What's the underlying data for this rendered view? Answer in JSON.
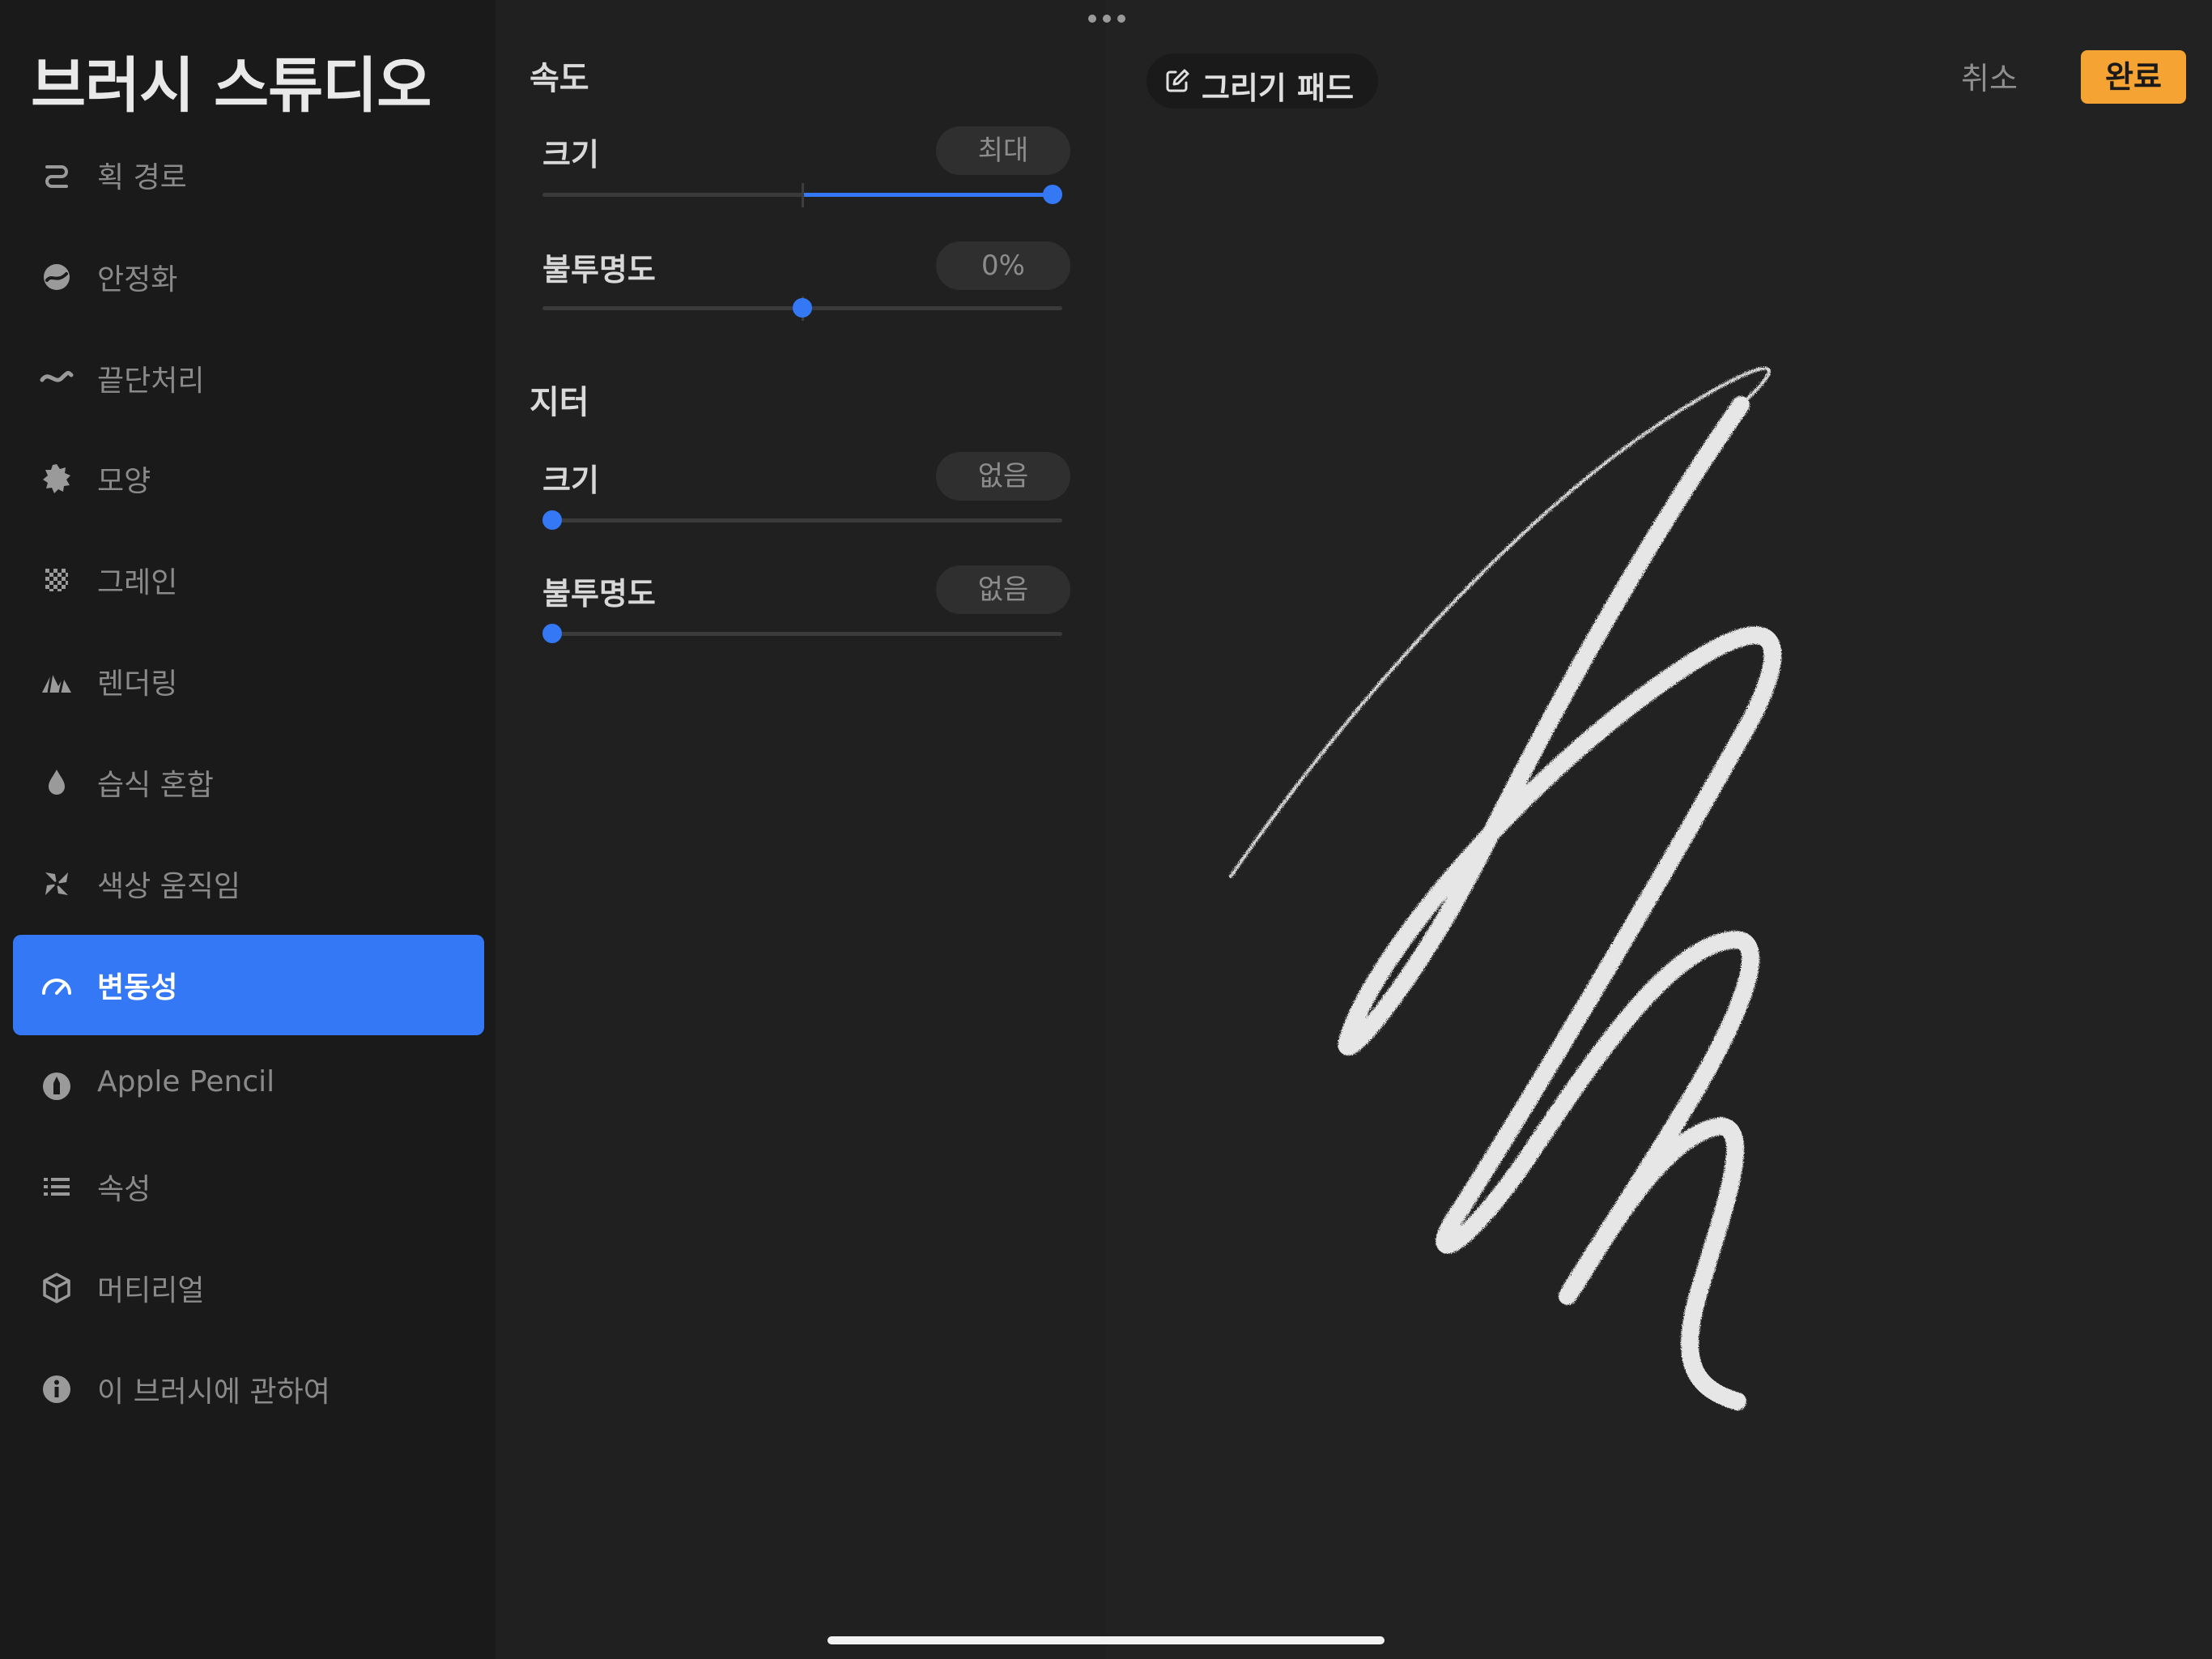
{
  "app": {
    "title": "브러시 스튜디오"
  },
  "sidebar": {
    "items": [
      {
        "label": "획 경로",
        "icon": "stroke-path-icon",
        "active": false
      },
      {
        "label": "안정화",
        "icon": "stabilization-icon",
        "active": false
      },
      {
        "label": "끝단처리",
        "icon": "taper-icon",
        "active": false
      },
      {
        "label": "모양",
        "icon": "shape-icon",
        "active": false
      },
      {
        "label": "그레인",
        "icon": "grain-icon",
        "active": false
      },
      {
        "label": "렌더링",
        "icon": "rendering-icon",
        "active": false
      },
      {
        "label": "습식 혼합",
        "icon": "wet-mix-icon",
        "active": false
      },
      {
        "label": "색상 움직임",
        "icon": "color-dynamics-icon",
        "active": false
      },
      {
        "label": "변동성",
        "icon": "dynamics-gauge-icon",
        "active": true
      },
      {
        "label": "Apple Pencil",
        "icon": "apple-pencil-icon",
        "active": false
      },
      {
        "label": "속성",
        "icon": "properties-list-icon",
        "active": false
      },
      {
        "label": "머티리얼",
        "icon": "materials-cube-icon",
        "active": false
      },
      {
        "label": "이 브러시에 관하여",
        "icon": "info-icon",
        "active": false
      }
    ]
  },
  "panel": {
    "speed": {
      "title": "속도",
      "size": {
        "label": "크기",
        "value": "최대",
        "level": 1.0,
        "bipolar": true
      },
      "opacity": {
        "label": "불투명도",
        "value": "0%",
        "level": 0.5,
        "bipolar": true
      }
    },
    "jitter": {
      "title": "지터",
      "size": {
        "label": "크기",
        "value": "없음",
        "level": 0.0,
        "bipolar": false
      },
      "opacity": {
        "label": "불투명도",
        "value": "없음",
        "level": 0.0,
        "bipolar": false
      }
    }
  },
  "canvas": {
    "drawing_pad_label": "그리기 패드",
    "drawing_pad_icon": "edit-square-icon",
    "cancel_label": "취소",
    "done_label": "완료"
  },
  "colors": {
    "accent": "#3478f6",
    "done": "#f5a332",
    "sidebar_bg": "#1a1a1a",
    "panel_bg": "#202020",
    "canvas_bg": "#222222"
  }
}
